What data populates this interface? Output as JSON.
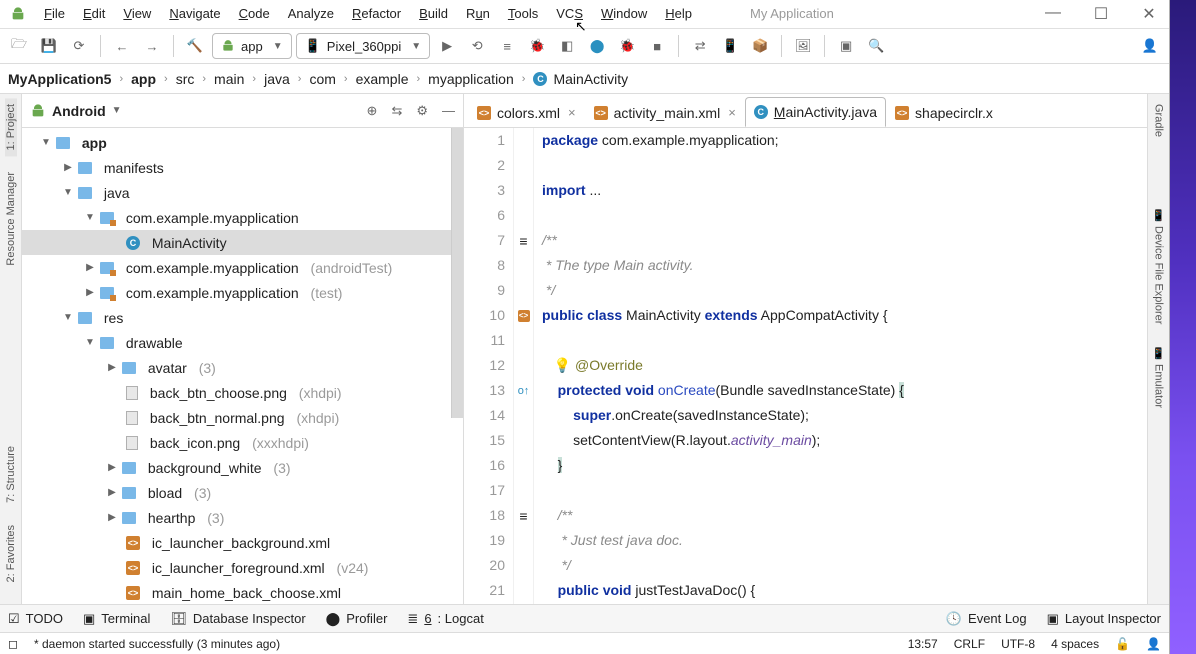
{
  "window": {
    "title": "My Application"
  },
  "menu": {
    "file": "File",
    "edit": "Edit",
    "view": "View",
    "navigate": "Navigate",
    "code": "Code",
    "analyze": "Analyze",
    "refactor": "Refactor",
    "build": "Build",
    "run": "Run",
    "tools": "Tools",
    "vcs": "VCS",
    "window": "Window",
    "help": "Help"
  },
  "toolbar": {
    "module": "app",
    "device": "Pixel_360ppi"
  },
  "breadcrumb": [
    "MyApplication5",
    "app",
    "src",
    "main",
    "java",
    "com",
    "example",
    "myapplication",
    "MainActivity"
  ],
  "projectPanel": {
    "mode": "Android",
    "tree": {
      "app": "app",
      "manifests": "manifests",
      "java": "java",
      "pkg": "com.example.myapplication",
      "mainActivity": "MainActivity",
      "pkgAndroidTest": "com.example.myapplication",
      "pkgAndroidTestHint": "(androidTest)",
      "pkgTest": "com.example.myapplication",
      "pkgTestHint": "(test)",
      "res": "res",
      "drawable": "drawable",
      "avatar": "avatar",
      "avatarHint": "(3)",
      "backBtnChoose": "back_btn_choose.png",
      "backBtnChooseHint": "(xhdpi)",
      "backBtnNormal": "back_btn_normal.png",
      "backBtnNormalHint": "(xhdpi)",
      "backIcon": "back_icon.png",
      "backIconHint": "(xxxhdpi)",
      "backgroundWhite": "background_white",
      "backgroundWhiteHint": "(3)",
      "bload": "bload",
      "bloadHint": "(3)",
      "hearthp": "hearthp",
      "hearthpHint": "(3)",
      "icLauncherBg": "ic_launcher_background.xml",
      "icLauncherFg": "ic_launcher_foreground.xml",
      "icLauncherFgHint": "(v24)",
      "mainHome": "main_home_back_choose.xml"
    }
  },
  "tabs": [
    {
      "label": "colors.xml",
      "type": "xml",
      "active": false
    },
    {
      "label": "activity_main.xml",
      "type": "xml",
      "active": false
    },
    {
      "label": "MainActivity.java",
      "type": "java",
      "active": true,
      "underline": "M"
    },
    {
      "label": "shapecirclr.x",
      "type": "xml",
      "active": false,
      "overflow": true
    }
  ],
  "gutterLines": [
    "1",
    "2",
    "3",
    "6",
    "7",
    "8",
    "9",
    "10",
    "11",
    "12",
    "13",
    "14",
    "15",
    "16",
    "17",
    "18",
    "19",
    "20",
    "21"
  ],
  "code": {
    "l1a": "package",
    "l1b": " com.example.myapplication;",
    "l3a": "import",
    "l3b": " ...",
    "l7": "/**",
    "l8": " * The type Main activity.",
    "l9": " */",
    "l10a": "public",
    "l10b": "class",
    "l10c": " MainActivity ",
    "l10d": "extends",
    "l10e": " AppCompatActivity {",
    "l12": "@Override",
    "l13a": "protected",
    "l13b": "void",
    "l13c": "onCreate",
    "l13d": "(Bundle savedInstanceState) ",
    "l13e": "{",
    "l14a": "super",
    "l14b": ".onCreate(savedInstanceState);",
    "l15a": "setContentView(R.layout.",
    "l15b": "activity_main",
    "l15c": ");",
    "l16": "}",
    "l18": "/**",
    "l19": " * Just test java doc.",
    "l20": " */",
    "l21a": "public",
    "l21b": "void",
    "l21c": " justTestJavaDoc() {"
  },
  "leftEdge": {
    "project": "1: Project",
    "resmgr": "Resource Manager",
    "structure": "7: Structure",
    "favorites": "2: Favorites"
  },
  "rightEdge": {
    "gradle": "Gradle",
    "devexplorer": "Device File Explorer",
    "emulator": "Emulator"
  },
  "bottombar": {
    "todo": "TODO",
    "terminal": "Terminal",
    "dbinspector": "Database Inspector",
    "profiler": "Profiler",
    "logcat": "6: Logcat",
    "eventlog": "Event Log",
    "layoutinspector": "Layout Inspector"
  },
  "statusbar": {
    "msg": "* daemon started successfully (3 minutes ago)",
    "time": "13:57",
    "enc": "CRLF",
    "charset": "UTF-8",
    "indent": "4 spaces"
  },
  "chart_data": null
}
